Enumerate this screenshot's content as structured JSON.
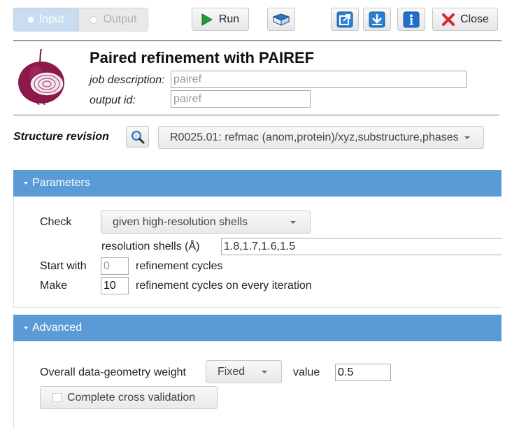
{
  "toolbar": {
    "input_label": "Input",
    "output_label": "Output",
    "run_label": "Run",
    "close_label": "Close"
  },
  "task": {
    "title": "Paired refinement with PAIREF",
    "job_description_label": "job description:",
    "job_description_value": "pairef",
    "output_id_label": "output id:",
    "output_id_value": "pairef"
  },
  "structure": {
    "label": "Structure revision",
    "selected": "R0025.01: refmac (anom,protein)/xyz,substructure,phases"
  },
  "parameters": {
    "header": "Parameters",
    "check_label": "Check",
    "check_value": "given high-resolution shells",
    "shells_label": "resolution shells (Å)",
    "shells_value": "1.8,1.7,1.6,1.5",
    "start_with_label": "Start with",
    "start_with_placeholder": "0",
    "start_with_suffix": "refinement cycles",
    "make_label": "Make",
    "make_value": "10",
    "make_suffix": "refinement cycles on every iteration"
  },
  "advanced": {
    "header": "Advanced",
    "weight_label": "Overall data-geometry weight",
    "weight_mode": "Fixed",
    "value_label": "value",
    "weight_value": "0.5",
    "cross_validation_label": "Complete cross validation"
  },
  "colors": {
    "section_header": "#5b9bd5",
    "input_toggle_active": "#c9dcf0",
    "run_icon": "#1e9e3a",
    "close_icon": "#d9272e",
    "onion": "#8b1a4a"
  }
}
